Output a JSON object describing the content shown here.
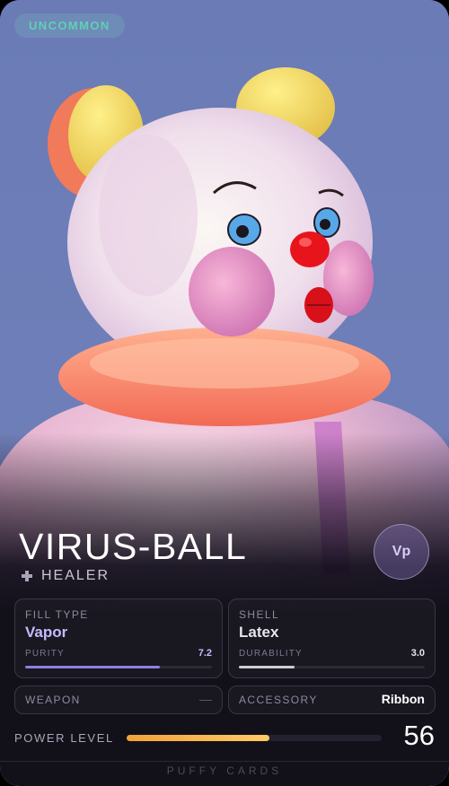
{
  "card": {
    "rarity": "UNCOMMON",
    "name": "VIRUS-BALL",
    "role": "HEALER",
    "role_icon": "plus-icon",
    "badge": "Vp",
    "fill": {
      "label": "FILL TYPE",
      "value": "Vapor",
      "stat_label": "PURITY",
      "stat_value": "7.2",
      "level": 0.72,
      "color": "#c5b9ff",
      "bar_color": "#8f7fe0"
    },
    "shell": {
      "label": "SHELL",
      "value": "Latex",
      "stat_label": "DURABILITY",
      "stat_value": "3.0",
      "level": 0.3,
      "color": "#e7e3f0",
      "bar_color": "#cfcbd8"
    },
    "weapon": {
      "label": "WEAPON",
      "value": "—"
    },
    "accessory": {
      "label": "ACCESSORY",
      "value": "Ribbon"
    },
    "power": {
      "label": "POWER LEVEL",
      "value": "56",
      "level": 0.56
    },
    "footer": "PUFFY CARDS"
  },
  "colors": {
    "rarity_text": "#5fd0b5",
    "power_bar": "#f0a23a",
    "background": "#121019"
  }
}
